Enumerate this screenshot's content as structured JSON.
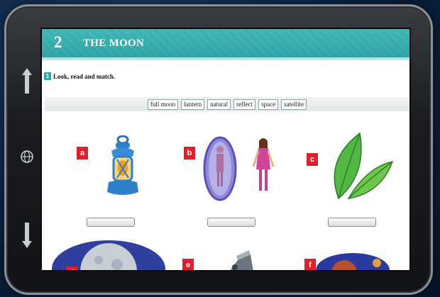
{
  "device": {
    "icons": [
      "arrow-up-icon",
      "globe-icon",
      "arrow-down-icon"
    ]
  },
  "page": {
    "unit_number": "2",
    "unit_title": "THE MOON",
    "header_color": "#33aaaa"
  },
  "exercise": {
    "number": "1",
    "instruction": "Look, read and match.",
    "words": [
      "full moon",
      "lantern",
      "natural",
      "reflect",
      "space",
      "satellite"
    ]
  },
  "items": [
    {
      "letter": "a",
      "picture": "lantern-picture",
      "answer": ""
    },
    {
      "letter": "b",
      "picture": "mirror-reflection-picture",
      "answer": ""
    },
    {
      "letter": "c",
      "picture": "leaves-picture",
      "answer": ""
    },
    {
      "letter": "d",
      "picture": "full-moon-picture",
      "answer": ""
    },
    {
      "letter": "e",
      "picture": "satellite-picture",
      "answer": ""
    },
    {
      "letter": "f",
      "picture": "space-planet-picture",
      "answer": ""
    }
  ],
  "colors": {
    "badge": "#e11e2b",
    "accent": "#35a9a9"
  }
}
